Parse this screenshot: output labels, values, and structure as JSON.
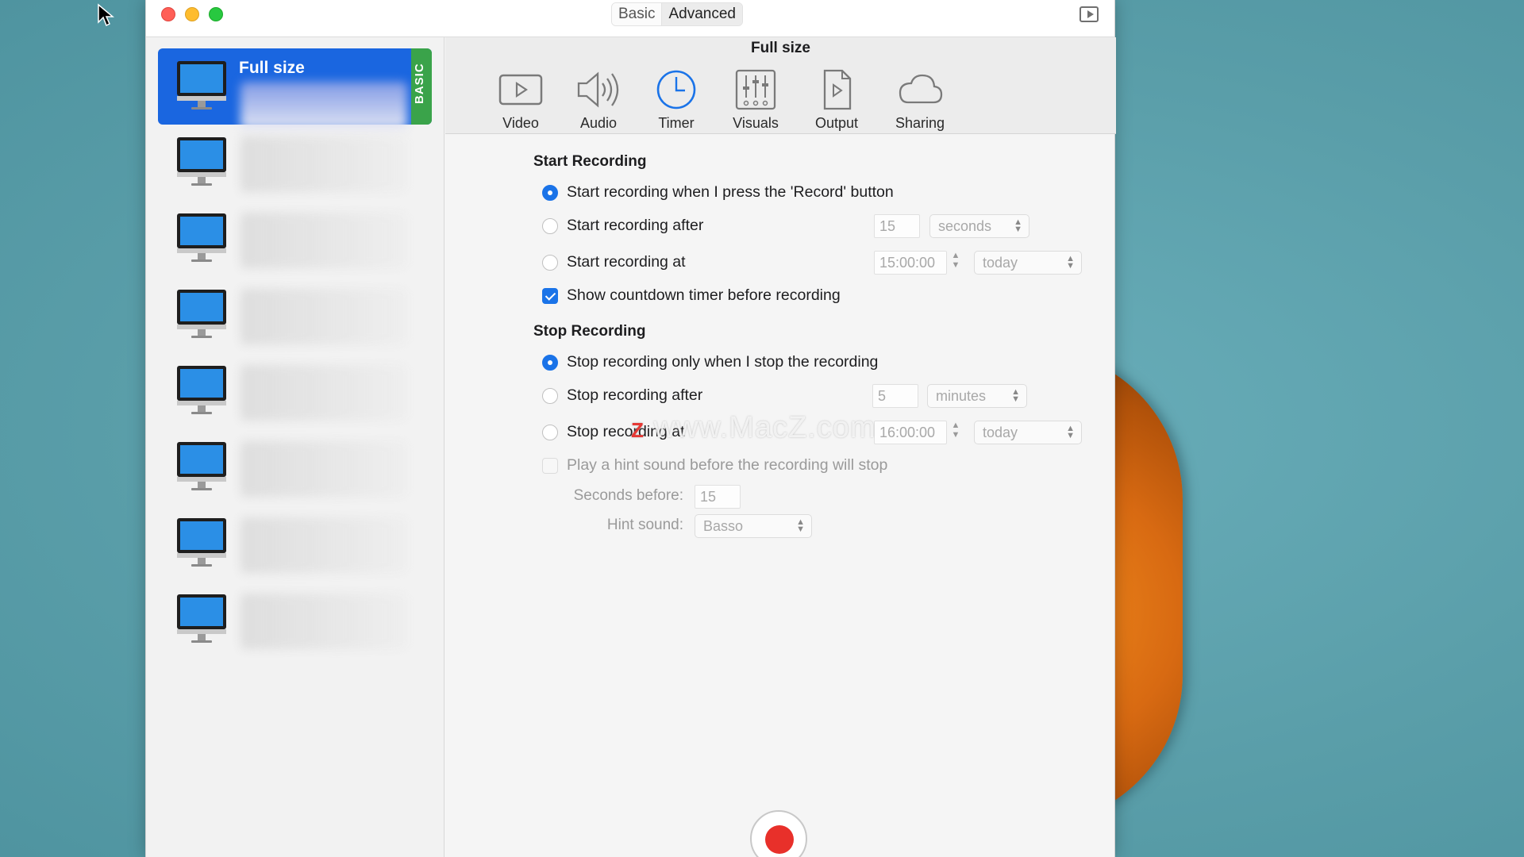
{
  "titlebar": {
    "modes": [
      "Basic",
      "Advanced"
    ],
    "active_mode": "Advanced"
  },
  "sidebar": {
    "presets": [
      {
        "name": "Full size",
        "badge": "BASIC",
        "selected": true
      },
      {
        "name": ""
      },
      {
        "name": ""
      },
      {
        "name": ""
      },
      {
        "name": ""
      },
      {
        "name": ""
      },
      {
        "name": ""
      },
      {
        "name": ""
      }
    ]
  },
  "header": {
    "preset_title": "Full size"
  },
  "toolbar": {
    "tabs": [
      {
        "label": "Video",
        "icon": "video-icon"
      },
      {
        "label": "Audio",
        "icon": "speaker-icon"
      },
      {
        "label": "Timer",
        "icon": "clock-icon",
        "active": true
      },
      {
        "label": "Visuals",
        "icon": "sliders-icon"
      },
      {
        "label": "Output",
        "icon": "document-play-icon"
      },
      {
        "label": "Sharing",
        "icon": "cloud-icon"
      }
    ]
  },
  "start": {
    "title": "Start Recording",
    "opt_press": "Start recording when I press the 'Record' button",
    "opt_after": "Start recording after",
    "after_value": "15",
    "after_unit": "seconds",
    "opt_at": "Start recording at",
    "at_time": "15:00:00",
    "at_day": "today",
    "countdown": "Show countdown timer before recording"
  },
  "stop": {
    "title": "Stop Recording",
    "opt_manual": "Stop recording only when I stop the recording",
    "opt_after": "Stop recording after",
    "after_value": "5",
    "after_unit": "minutes",
    "opt_at": "Stop recording at",
    "at_time": "16:00:00",
    "at_day": "today",
    "hint": "Play a hint sound before the recording will stop",
    "seconds_before_label": "Seconds before:",
    "seconds_before_value": "15",
    "hint_sound_label": "Hint sound:",
    "hint_sound_value": "Basso"
  },
  "watermark": "www.MacZ.com",
  "colors": {
    "accent": "#1a73e8",
    "selection": "#1a66e0",
    "basic_badge": "#3aa34a",
    "record": "#e8302a"
  }
}
